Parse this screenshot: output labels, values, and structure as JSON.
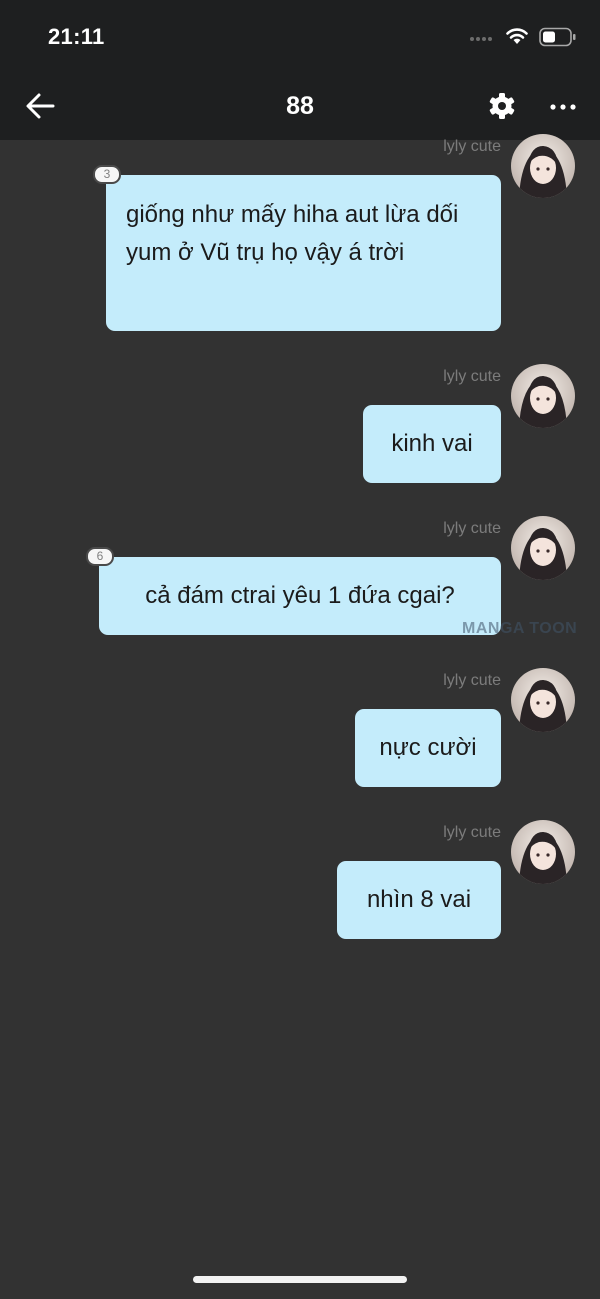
{
  "status_bar": {
    "time": "21:11"
  },
  "header": {
    "title": "88"
  },
  "messages": [
    {
      "sender": "lyly cute",
      "text": "giống như mấy hiha aut lừa dối yum ở Vũ trụ họ vậy á trời",
      "reply_count": "3"
    },
    {
      "sender": "lyly cute",
      "text": "kinh vai"
    },
    {
      "sender": "lyly cute",
      "text": "cả đám ctrai yêu 1 đứa cgai?",
      "reply_count": "6"
    },
    {
      "sender": "lyly cute",
      "text": "nực cười"
    },
    {
      "sender": "lyly cute",
      "text": "nhìn 8 vai"
    }
  ],
  "watermark": "MANGA TOON",
  "colors": {
    "background": "#323232",
    "header": "#1e1f20",
    "bubble": "#c4ecfb",
    "sender_name": "#7c7c7c"
  },
  "icons": [
    "back-arrow-icon",
    "gear-icon",
    "more-icon",
    "wifi-icon",
    "battery-icon"
  ]
}
